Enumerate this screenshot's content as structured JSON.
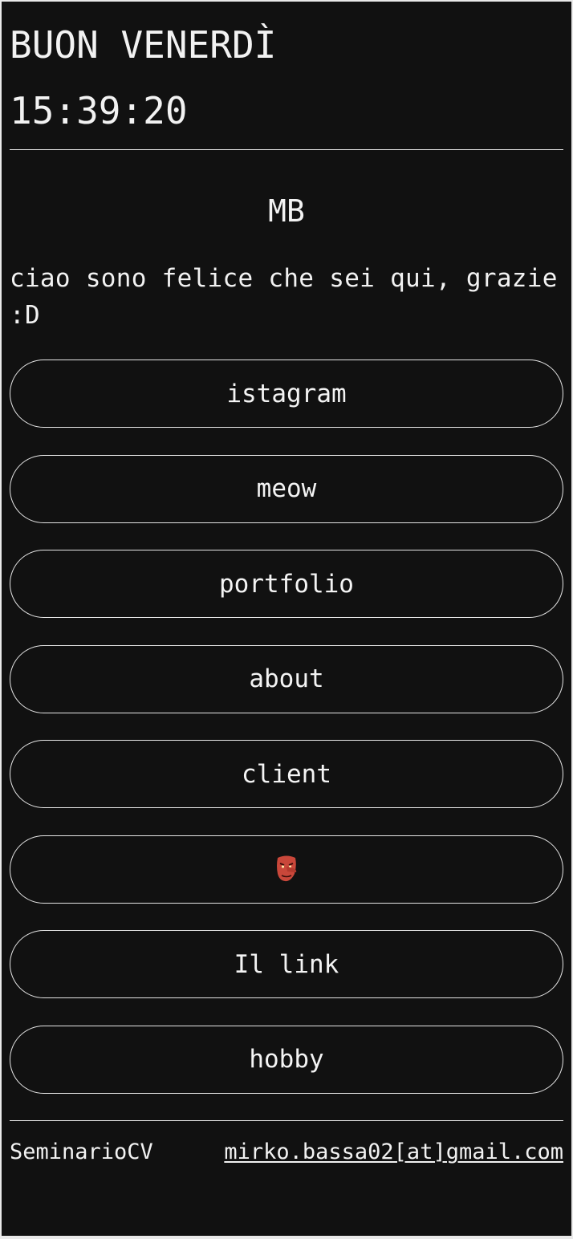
{
  "header": {
    "greeting": "BUON VENERDÌ",
    "clock": "15:39:20"
  },
  "profile": {
    "monogram": "MB",
    "intro": "ciao sono felice che sei qui, grazie :D"
  },
  "links": [
    {
      "label": "istagram"
    },
    {
      "label": "meow"
    },
    {
      "label": "portfolio"
    },
    {
      "label": "about"
    },
    {
      "label": "client"
    },
    {
      "label": "",
      "icon": "tengu-mask-icon"
    },
    {
      "label": "Il link"
    },
    {
      "label": "hobby"
    }
  ],
  "footer": {
    "left_text": "SeminarioCV",
    "email": "mirko.bassa02[at]gmail.com"
  },
  "colors": {
    "background": "#111111",
    "text": "#f2f2f2",
    "border": "#e6e6e6",
    "mask_red": "#c9473a"
  }
}
